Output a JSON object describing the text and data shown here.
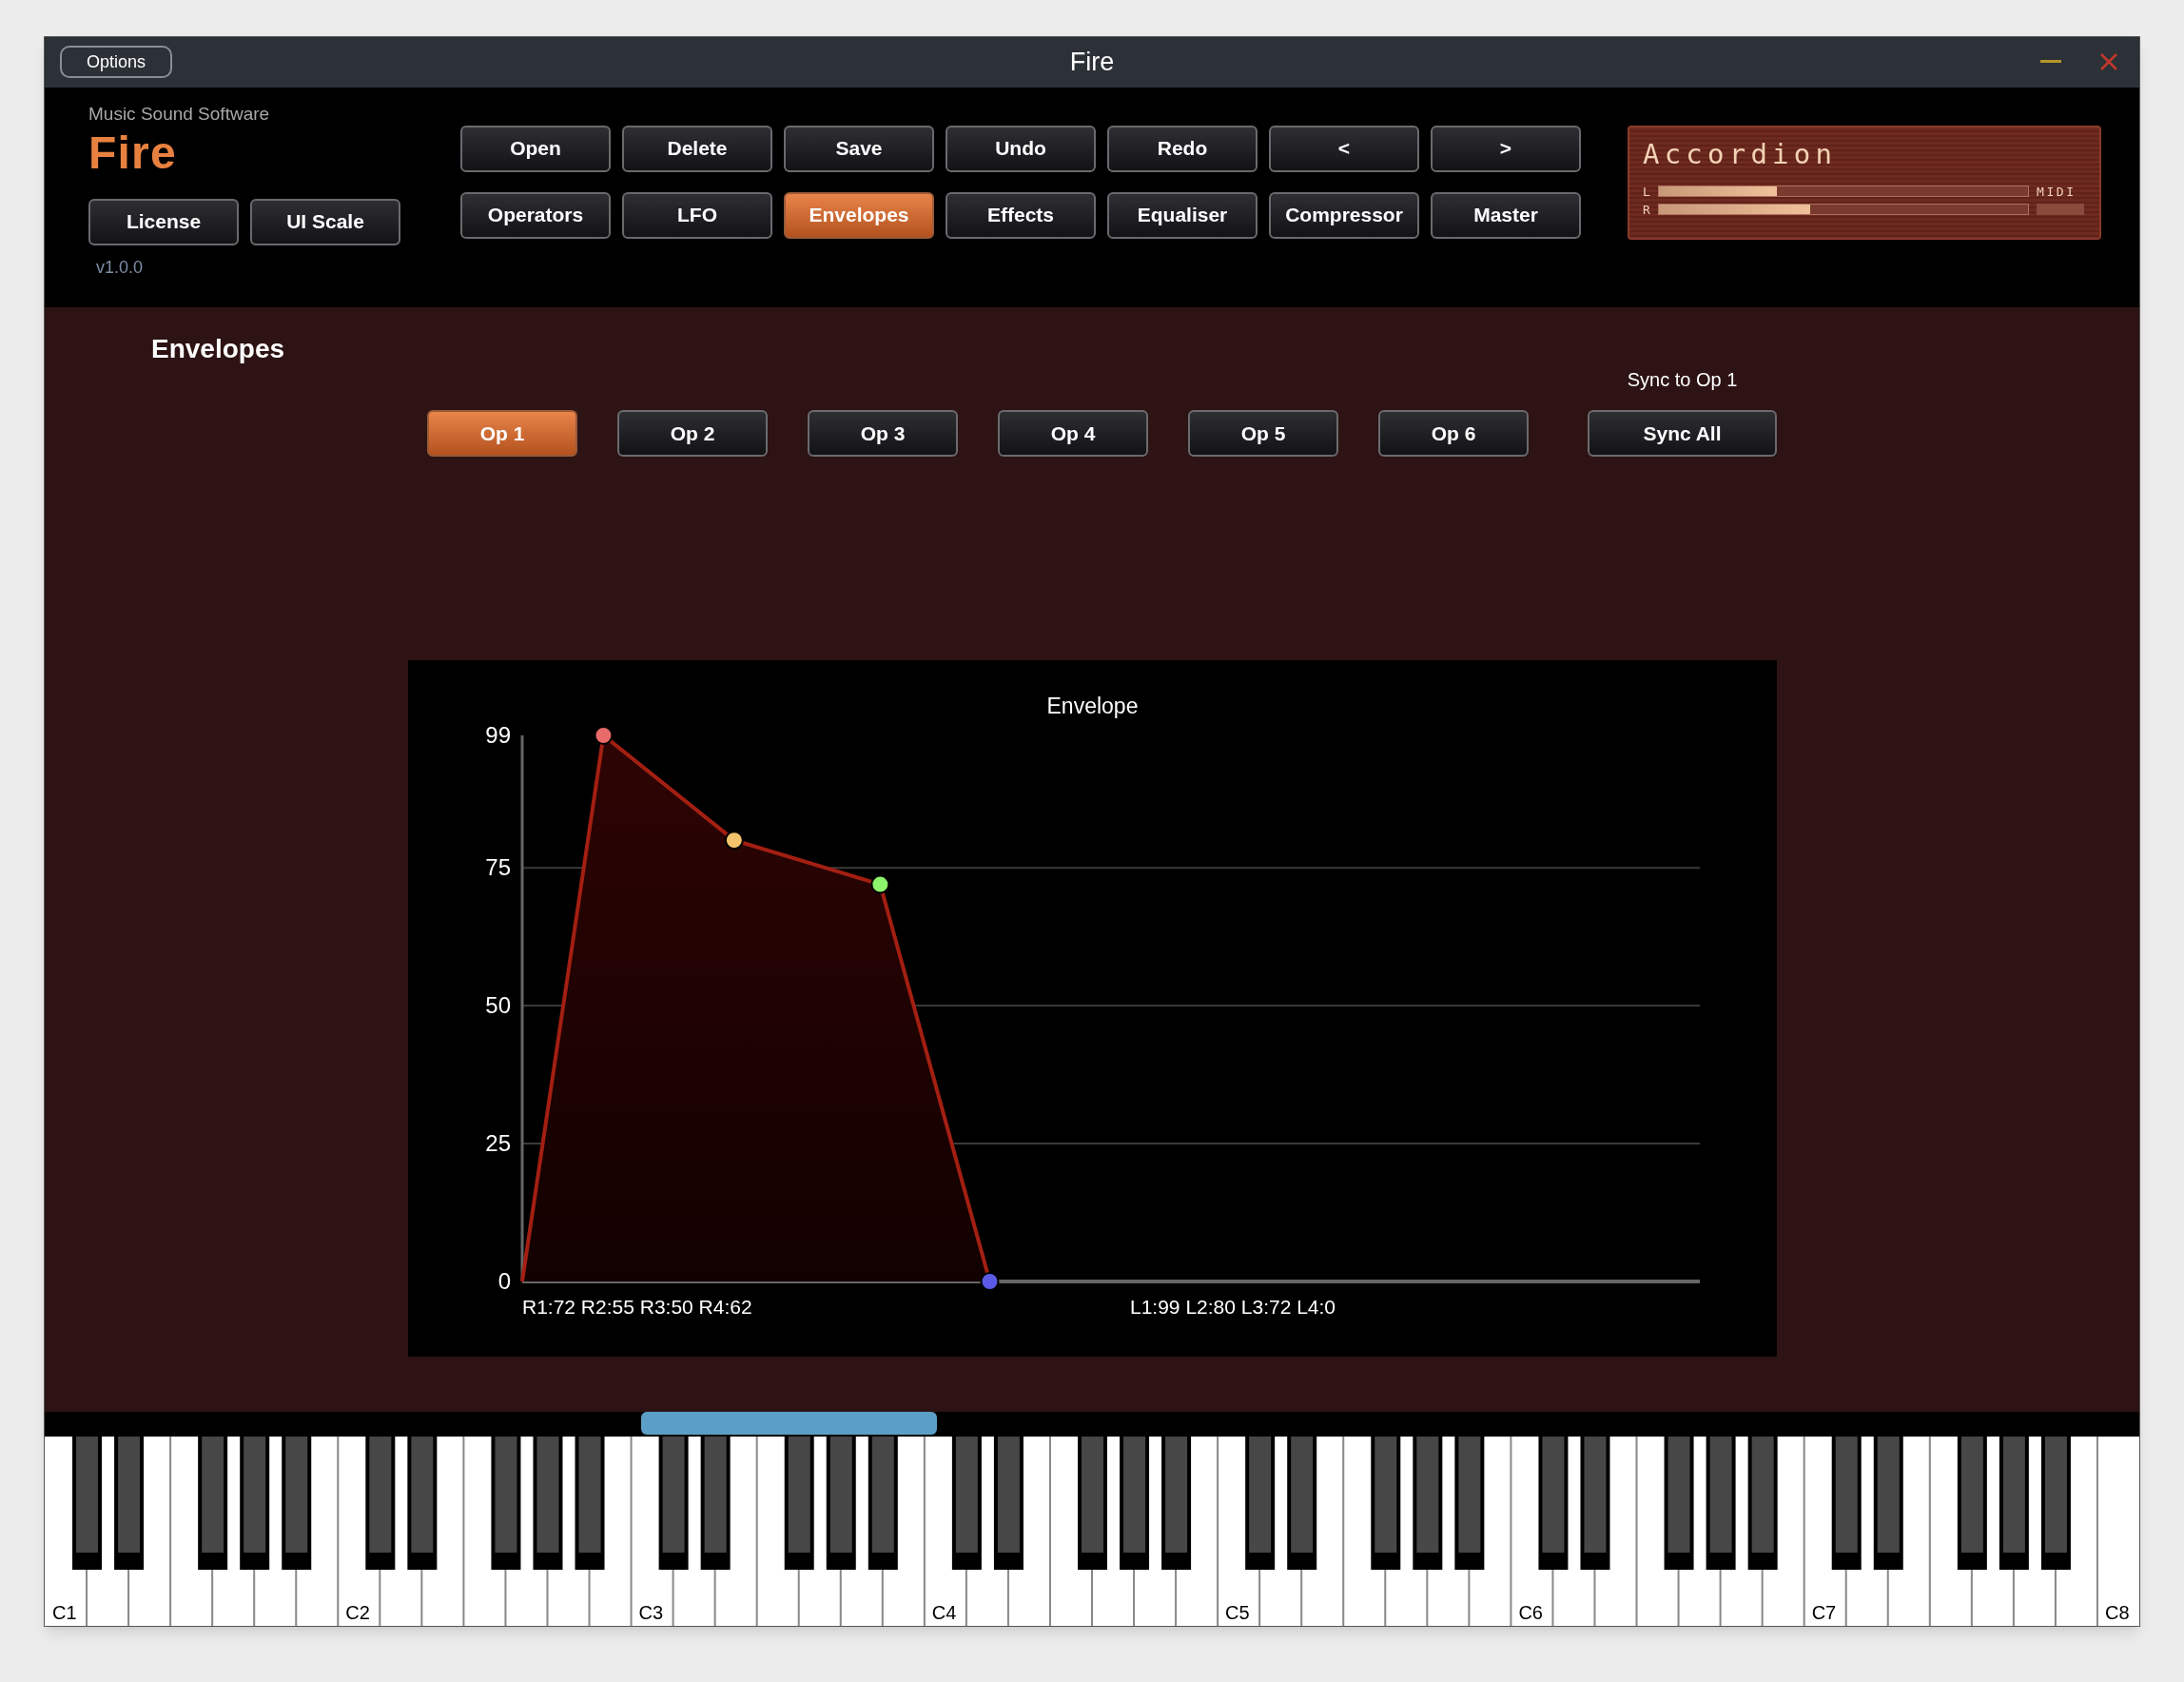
{
  "window": {
    "title": "Fire",
    "options_button": "Options"
  },
  "brand": {
    "company": "Music Sound Software",
    "product": "Fire",
    "version": "v1.0.0"
  },
  "side_buttons": [
    "License",
    "UI Scale"
  ],
  "toolbar": {
    "actions": [
      {
        "label": "Open"
      },
      {
        "label": "Delete"
      },
      {
        "label": "Save"
      },
      {
        "label": "Undo"
      },
      {
        "label": "Redo"
      },
      {
        "label": "<"
      },
      {
        "label": ">"
      }
    ],
    "pages": [
      {
        "label": "Operators",
        "selected": false
      },
      {
        "label": "LFO",
        "selected": false
      },
      {
        "label": "Envelopes",
        "selected": true
      },
      {
        "label": "Effects",
        "selected": false
      },
      {
        "label": "Equaliser",
        "selected": false
      },
      {
        "label": "Compressor",
        "selected": false
      },
      {
        "label": "Master",
        "selected": false
      }
    ]
  },
  "preset": {
    "name": "Accordion",
    "meters": [
      {
        "label": "L",
        "level": 0.32
      },
      {
        "label": "R",
        "level": 0.41
      }
    ],
    "midi_label": "MIDI"
  },
  "page": {
    "heading": "Envelopes",
    "sync_label": "Sync to Op 1",
    "operators": [
      {
        "label": "Op 1",
        "selected": true
      },
      {
        "label": "Op 2",
        "selected": false
      },
      {
        "label": "Op 3",
        "selected": false
      },
      {
        "label": "Op 4",
        "selected": false
      },
      {
        "label": "Op 5",
        "selected": false
      },
      {
        "label": "Op 6",
        "selected": false
      }
    ],
    "sync_all_button": "Sync All"
  },
  "envelope": {
    "title": "Envelope",
    "y_tick_labels": [
      "99",
      "75",
      "50",
      "25",
      "0"
    ],
    "points": [
      {
        "color": "#e86a6a"
      },
      {
        "color": "#f3c46c"
      },
      {
        "color": "#8cf56c"
      },
      {
        "color": "#5a5ae6"
      }
    ],
    "rates_label": "R1:72 R2:55 R3:50 R4:62",
    "levels_label": "L1:99 L2:80 L3:72 L4:0"
  },
  "keyboard": {
    "octave_labels": [
      "C1",
      "C2",
      "C3",
      "C4",
      "C5",
      "C6",
      "C7",
      "C8"
    ]
  }
}
